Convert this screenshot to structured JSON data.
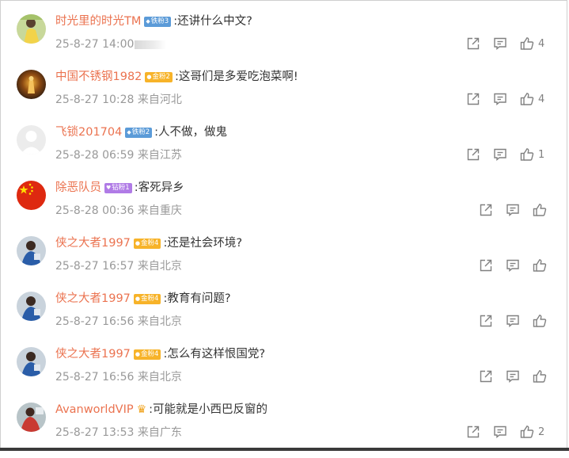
{
  "comments": [
    {
      "username": "时光里的时光TM",
      "badge": "铁粉3",
      "badge_color": "blue",
      "text": ":还讲什么中文?",
      "date": "25-8-27 14:00",
      "location": "",
      "likes": "4",
      "avatar": "girl-yellow-dress"
    },
    {
      "username": "中国不锈钢1982",
      "badge": "金粉2",
      "badge_color": "orange",
      "text": ":这哥们是多爱吃泡菜啊!",
      "date": "25-8-27 10:28",
      "location": "来自河北",
      "likes": "4",
      "avatar": "golden-statue"
    },
    {
      "username": "飞锁201704",
      "badge": "铁粉2",
      "badge_color": "blue",
      "text": ":人不做，做鬼",
      "date": "25-8-28 06:59",
      "location": "来自江苏",
      "likes": "1",
      "avatar": "default-person"
    },
    {
      "username": "除恶队员",
      "badge": "钻粉1",
      "badge_color": "purple",
      "text": ":客死异乡",
      "date": "25-8-28 00:36",
      "location": "来自重庆",
      "likes": "",
      "avatar": "china-flag"
    },
    {
      "username": "侠之大者1997",
      "badge": "金粉4",
      "badge_color": "orange",
      "text": ":还是社会环境?",
      "date": "25-8-27 16:57",
      "location": "来自北京",
      "likes": "",
      "avatar": "person-blue"
    },
    {
      "username": "侠之大者1997",
      "badge": "金粉4",
      "badge_color": "orange",
      "text": ":教育有问题?",
      "date": "25-8-27 16:56",
      "location": "来自北京",
      "likes": "",
      "avatar": "person-blue"
    },
    {
      "username": "侠之大者1997",
      "badge": "金粉4",
      "badge_color": "orange",
      "text": ":怎么有这样恨国党?",
      "date": "25-8-27 16:56",
      "location": "来自北京",
      "likes": "",
      "avatar": "person-blue"
    },
    {
      "username": "AvanworldVIP",
      "badge": "",
      "badge_color": "",
      "crown": true,
      "text": ":可能就是小西巴反窗的",
      "date": "25-8-27 13:53",
      "location": "来自广东",
      "likes": "2",
      "avatar": "red-figure"
    }
  ],
  "colors": {
    "username": "#eb7350",
    "meta": "#999999",
    "icon": "#808080"
  }
}
